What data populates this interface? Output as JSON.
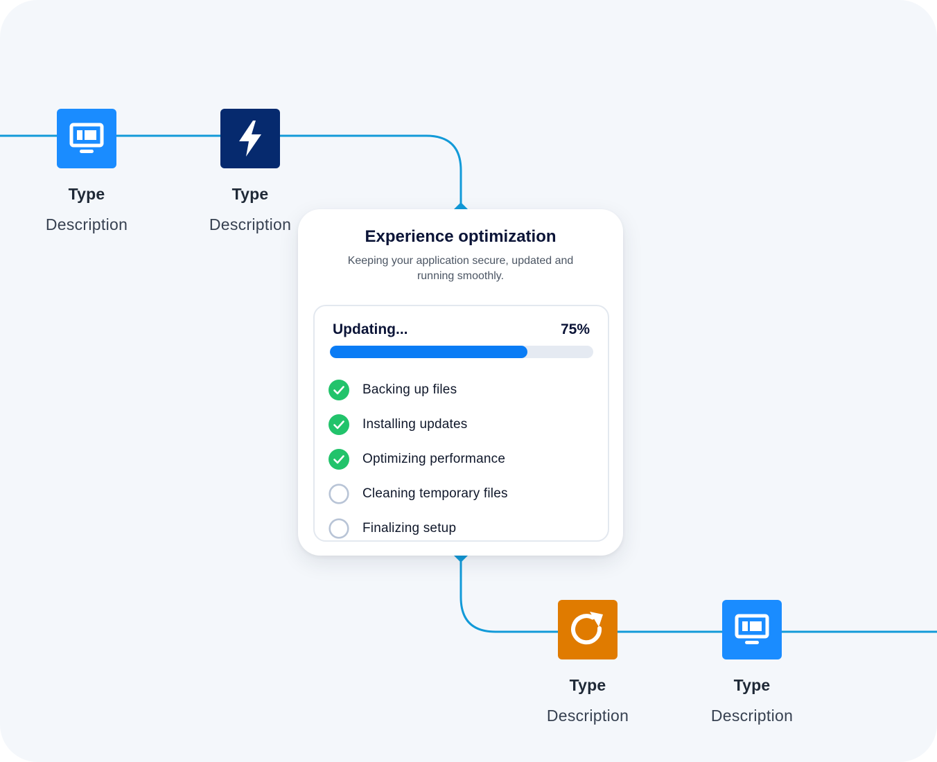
{
  "nodes": [
    {
      "type": "Type",
      "description": "Description",
      "icon": "monitor-icon",
      "color": "#1a8cff"
    },
    {
      "type": "Type",
      "description": "Description",
      "icon": "lightning-icon",
      "color": "#062a6e"
    },
    {
      "type": "Type",
      "description": "Description",
      "icon": "refresh-icon",
      "color": "#e07b00"
    },
    {
      "type": "Type",
      "description": "Description",
      "icon": "monitor-icon",
      "color": "#1a8cff"
    }
  ],
  "card": {
    "title": "Experience optimization",
    "subtitle": "Keeping your application secure, updated and running smoothly.",
    "status_label": "Updating...",
    "progress_percent": 75,
    "progress_text": "75%",
    "steps": [
      {
        "label": "Backing up files",
        "done": true
      },
      {
        "label": "Installing updates",
        "done": true
      },
      {
        "label": "Optimizing performance",
        "done": true
      },
      {
        "label": "Cleaning temporary files",
        "done": false
      },
      {
        "label": "Finalizing setup",
        "done": false
      }
    ]
  },
  "colors": {
    "connector": "#129ad8",
    "progress_fill": "#0a7cf5",
    "progress_track": "#e5eaf2",
    "check_done": "#22c36b",
    "check_pending": "#b8c4d6"
  }
}
